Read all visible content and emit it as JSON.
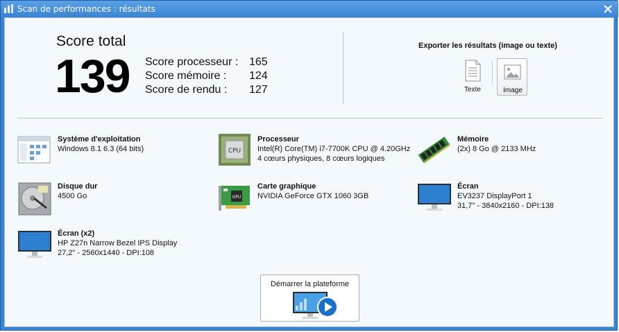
{
  "window": {
    "title": "Scan de performances : résultats",
    "close_symbol": "✕"
  },
  "score": {
    "title": "Score total",
    "total": "139",
    "rows": [
      {
        "label": "Score processeur :",
        "value": "165"
      },
      {
        "label": "Score mémoire :",
        "value": "124"
      },
      {
        "label": "Score de rendu :",
        "value": "127"
      }
    ]
  },
  "export": {
    "title": "Exporter les résultats (image ou texte)",
    "text_label": "Texte",
    "image_label": "Image"
  },
  "items": [
    {
      "name": "Système d'exploitation",
      "line1": "Windows 8.1 6.3 (64 bits)",
      "line2": "",
      "icon": "os-window-icon"
    },
    {
      "name": "Processeur",
      "line1": "Intel(R) Core(TM) i7-7700K CPU @ 4.20GHz",
      "line2": "4 cœurs physiques, 8 cœurs logiques",
      "icon": "cpu-icon"
    },
    {
      "name": "Mémoire",
      "line1": "(2x) 8 Go @ 2133 MHz",
      "line2": "",
      "icon": "ram-icon"
    },
    {
      "name": "Disque dur",
      "line1": "4500 Go",
      "line2": "",
      "icon": "hard-drive-icon"
    },
    {
      "name": "Carte graphique",
      "line1": "NVIDIA GeForce GTX 1060 3GB",
      "line2": "",
      "icon": "graphics-card-icon"
    },
    {
      "name": "Écran",
      "line1": "EV3237 DisplayPort 1",
      "line2": "31,7\" - 3840x2160 - DPI:138",
      "icon": "monitor-icon"
    },
    {
      "name": "Écran (x2)",
      "line1": "HP Z27n Narrow Bezel IPS Display",
      "line2": "27,2\" - 2560x1440 - DPI:108",
      "icon": "monitor-icon"
    }
  ],
  "icon_texts": {
    "cpu": "CPU",
    "gpu": "GPU"
  },
  "launch": {
    "label": "Démarrer la plateforme"
  },
  "colors": {
    "titlebar": "#3a84d3",
    "accent_blue": "#1a6fc9",
    "background": "#f4f9fd"
  }
}
